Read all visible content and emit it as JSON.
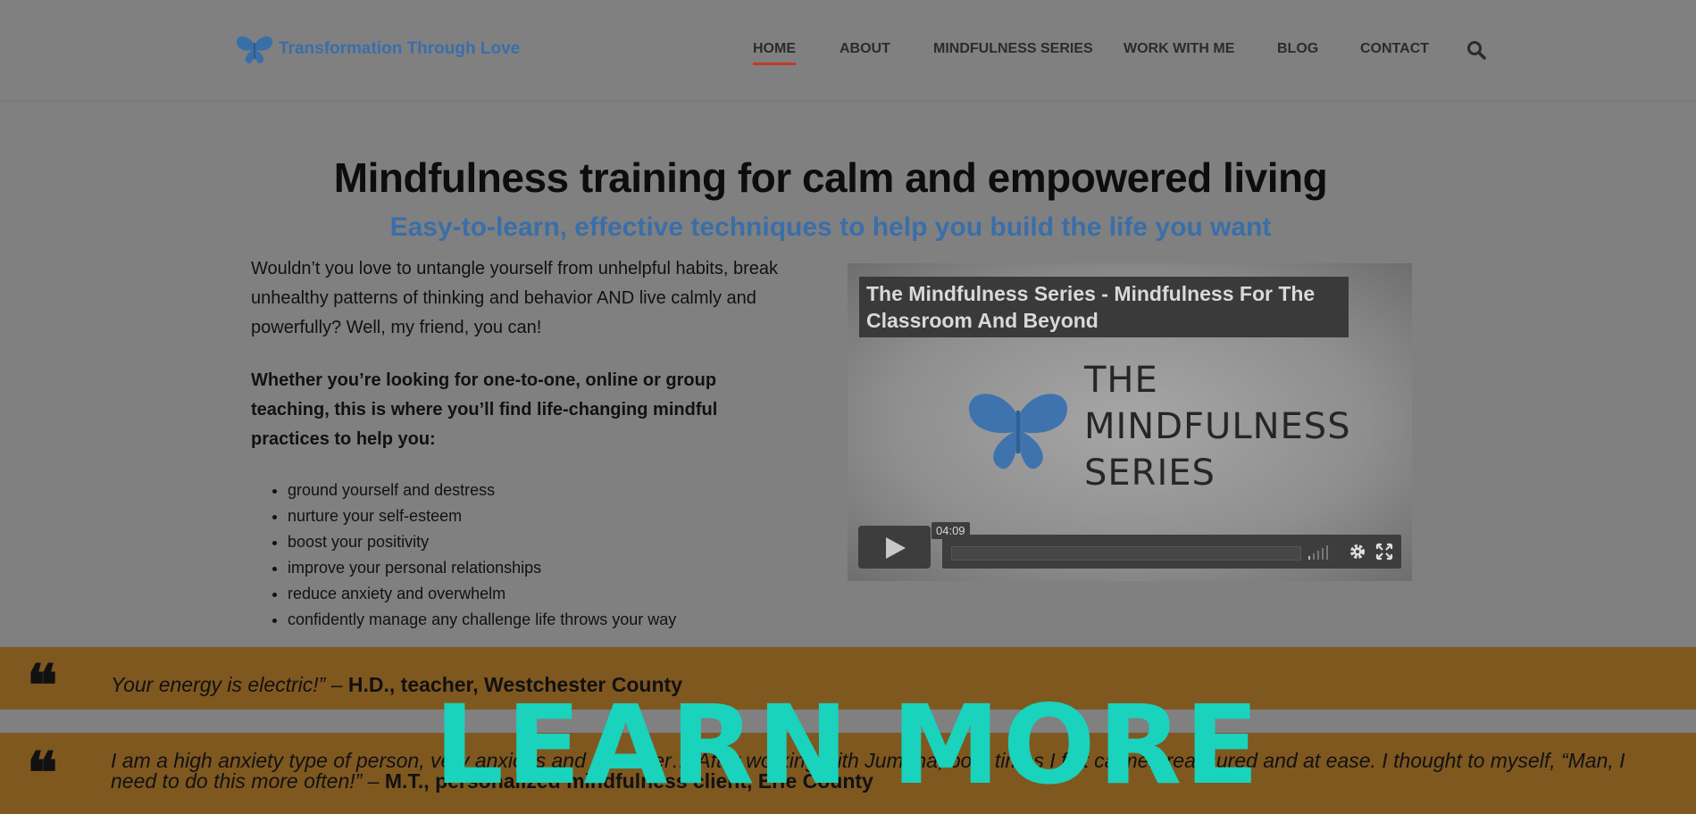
{
  "header": {
    "logo_text": "Transformation Through Love",
    "nav": [
      {
        "label": "HOME",
        "active": true
      },
      {
        "label": "ABOUT"
      },
      {
        "label": "MINDFULNESS SERIES"
      },
      {
        "label": "WORK WITH ME"
      },
      {
        "label": "BLOG"
      },
      {
        "label": "CONTACT"
      }
    ],
    "search_icon": "search-icon"
  },
  "hero": {
    "title": "Mindfulness training for calm and empowered living",
    "subtitle": "Easy-to-learn, effective techniques to help you build the life you want",
    "intro": "Wouldn’t you love to untangle yourself from unhelpful habits, break unhealthy patterns of thinking and behavior AND live calmly and powerfully? Well, my friend, you can!",
    "intro_bold": "Whether you’re looking for one-to-one, online or group teaching, this is where you’ll find life-changing mindful practices to help you:",
    "benefits": [
      "ground yourself and destress",
      "nurture your self-esteem",
      "boost your positivity",
      "improve your personal relationships",
      "reduce anxiety and overwhelm",
      "confidently manage any challenge life throws your way"
    ]
  },
  "video": {
    "title": "The Mindfulness Series - Mindfulness For The Classroom And Beyond",
    "brand_line1": "THE",
    "brand_line2": "MINDFULNESS",
    "brand_line3": "SERIES",
    "duration": "04:09"
  },
  "testimonials": [
    {
      "quote": "Your energy is electric!” – ",
      "author": "H.D., teacher, Westchester County"
    },
    {
      "quote": "I am a high anxiety type of person, very anxious and a worrier… After working with Jumana, both times I felt calmer, reassured and at ease. I thought to myself, “Man, I need to do this more often!” – ",
      "author": "M.T., personalized mindfulness client, Erie County"
    }
  ],
  "cta": {
    "label": "LEARN MORE"
  },
  "colors": {
    "accent_blue": "#3a6ea8",
    "band": "#7f5820",
    "cta": "#19d3bd",
    "active_underline": "#c0392b"
  }
}
